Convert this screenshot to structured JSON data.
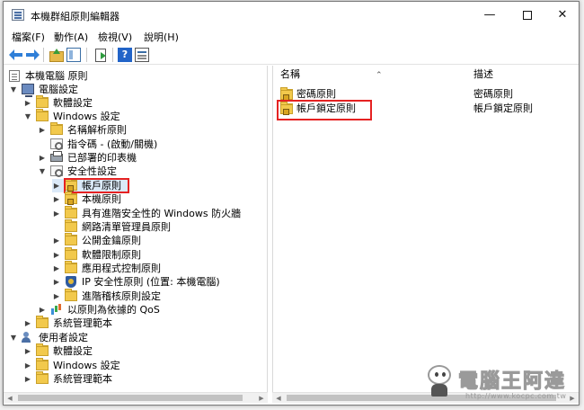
{
  "window": {
    "title": "本機群組原則編輯器",
    "controls": {
      "minimize": "—",
      "close": "✕"
    }
  },
  "menu": [
    "檔案(F)",
    "動作(A)",
    "檢視(V)",
    "說明(H)"
  ],
  "toolbar": {
    "help": "?"
  },
  "tree": [
    {
      "label": "本機電腦 原則",
      "icon": "doc-icon"
    },
    {
      "label": "電腦設定",
      "icon": "computer-icon"
    },
    {
      "label": "軟體設定",
      "icon": "folder-icon"
    },
    {
      "label": "Windows 設定",
      "icon": "folder-icon"
    },
    {
      "label": "名稱解析原則",
      "icon": "folder-icon"
    },
    {
      "label": "指令碼 - (啟動/關機)",
      "icon": "script-icon"
    },
    {
      "label": "已部署的印表機",
      "icon": "printer-icon"
    },
    {
      "label": "安全性設定",
      "icon": "security-settings-icon"
    },
    {
      "label": "帳戶原則",
      "icon": "folder-lock-icon"
    },
    {
      "label": "本機原則",
      "icon": "folder-lock-icon"
    },
    {
      "label": "具有進階安全性的 Windows 防火牆",
      "icon": "folder-icon"
    },
    {
      "label": "網路清單管理員原則",
      "icon": "folder-icon"
    },
    {
      "label": "公開金鑰原則",
      "icon": "folder-icon"
    },
    {
      "label": "軟體限制原則",
      "icon": "folder-icon"
    },
    {
      "label": "應用程式控制原則",
      "icon": "folder-icon"
    },
    {
      "label": "IP 安全性原則 (位置: 本機電腦)",
      "icon": "shield-icon"
    },
    {
      "label": "進階稽核原則設定",
      "icon": "folder-icon"
    },
    {
      "label": "以原則為依據的 QoS",
      "icon": "qos-chart-icon"
    },
    {
      "label": "系統管理範本",
      "icon": "folder-icon"
    },
    {
      "label": "使用者設定",
      "icon": "user-icon"
    },
    {
      "label": "軟體設定",
      "icon": "folder-icon"
    },
    {
      "label": "Windows 設定",
      "icon": "folder-icon"
    },
    {
      "label": "系統管理範本",
      "icon": "folder-icon"
    }
  ],
  "list": {
    "columns": {
      "name": "名稱",
      "description": "描述"
    },
    "rows": [
      {
        "name": "密碼原則",
        "description": "密碼原則"
      },
      {
        "name": "帳戶鎖定原則",
        "description": "帳戶鎖定原則"
      }
    ]
  },
  "watermark": {
    "title": "電腦王阿達",
    "url": "http://www.kocpc.com.tw"
  }
}
